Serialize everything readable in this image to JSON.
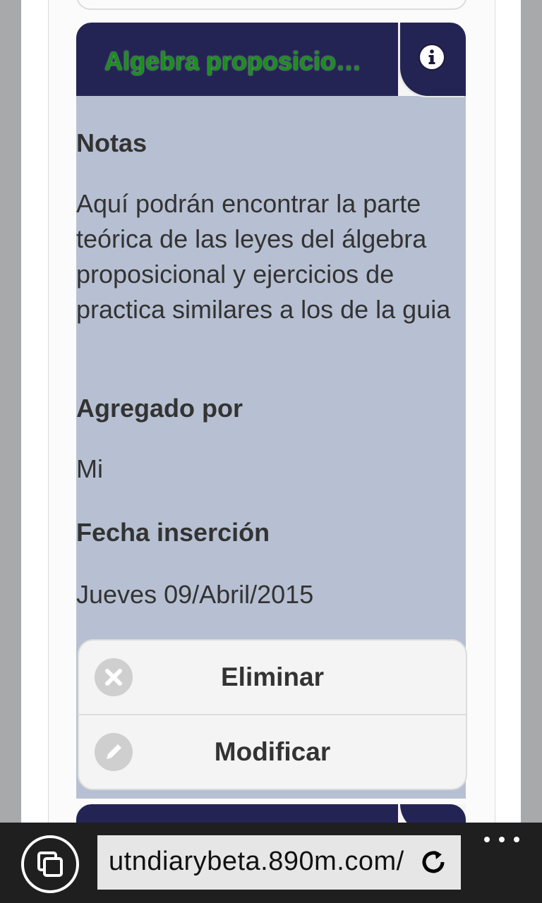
{
  "card": {
    "title": "Algebra proposicional",
    "info_icon": "info-icon",
    "sections": {
      "notes_label": "Notas",
      "notes_value": "Aquí podrán encontrar la parte teórica de las leyes del álgebra proposicional y ejercicios de practica similares a los de la guia",
      "added_by_label": "Agregado por",
      "added_by_value": "Mi",
      "date_label": "Fecha inserción",
      "date_value": "Jueves 09/Abril/2015"
    },
    "buttons": {
      "delete_label": "Eliminar",
      "delete_icon": "close-icon",
      "edit_label": "Modificar",
      "edit_icon": "pencil-icon"
    }
  },
  "browser": {
    "url": "utndiarybeta.890m.com/",
    "tabs_icon": "tabs-icon",
    "refresh_icon": "refresh-icon",
    "more_icon": "more-icon"
  },
  "colors": {
    "header_bg": "#242454",
    "title_color": "#1a8f1a",
    "card_body_bg": "#b7c0d2",
    "button_bg": "#f4f4f4",
    "browser_bar_bg": "#1f1f1f"
  }
}
